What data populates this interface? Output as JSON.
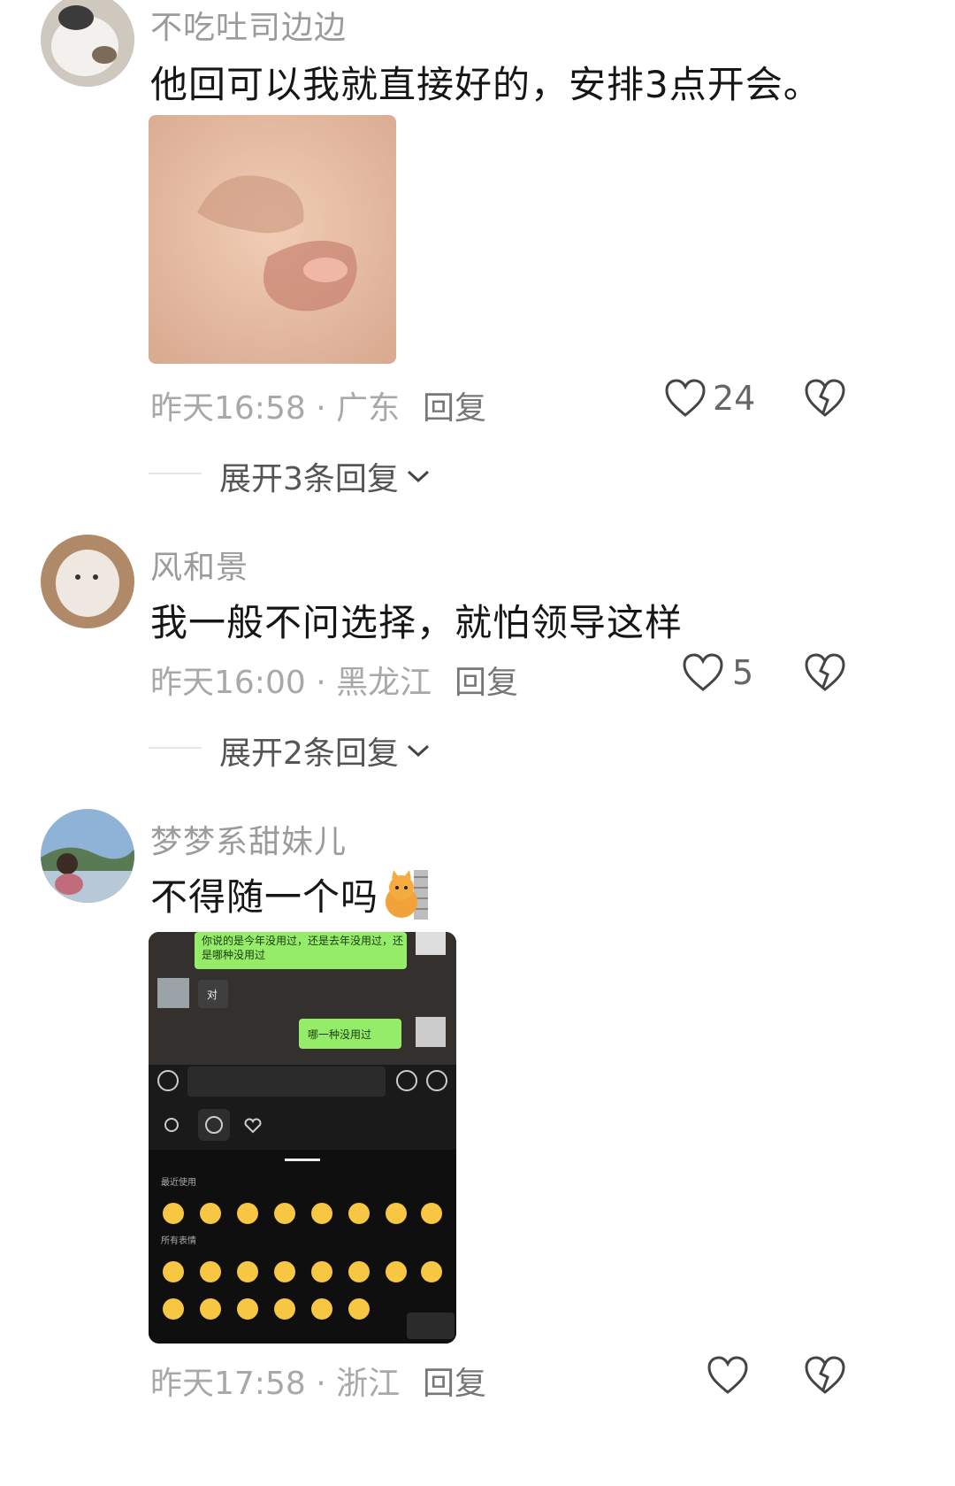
{
  "comments": [
    {
      "username": "不吃吐司边边",
      "text": "他回可以我就直接好的，安排3点开会。",
      "meta": "昨天16:58 · 广东",
      "reply_label": "回复",
      "likes": "24",
      "expand": "展开3条回复"
    },
    {
      "username": "风和景",
      "text": "我一般不问选择，就怕领导这样",
      "meta": "昨天16:00 · 黑龙江",
      "reply_label": "回复",
      "likes": "5",
      "expand": "展开2条回复"
    },
    {
      "username": "梦梦系甜妹儿",
      "text": "不得随一个吗",
      "meta": "昨天17:58 · 浙江",
      "reply_label": "回复",
      "likes": ""
    }
  ],
  "screenshot": {
    "msg_green_1": "你说的是今年没用过，还是去年没用过，还是哪种没用过",
    "msg_white": "对",
    "msg_green_2": "哪一种没用过",
    "label_recent": "最近使用",
    "label_all": "所有表情"
  },
  "colors": {
    "wechat_green": "#95ec69",
    "meta_gray": "#a8a8a8"
  }
}
